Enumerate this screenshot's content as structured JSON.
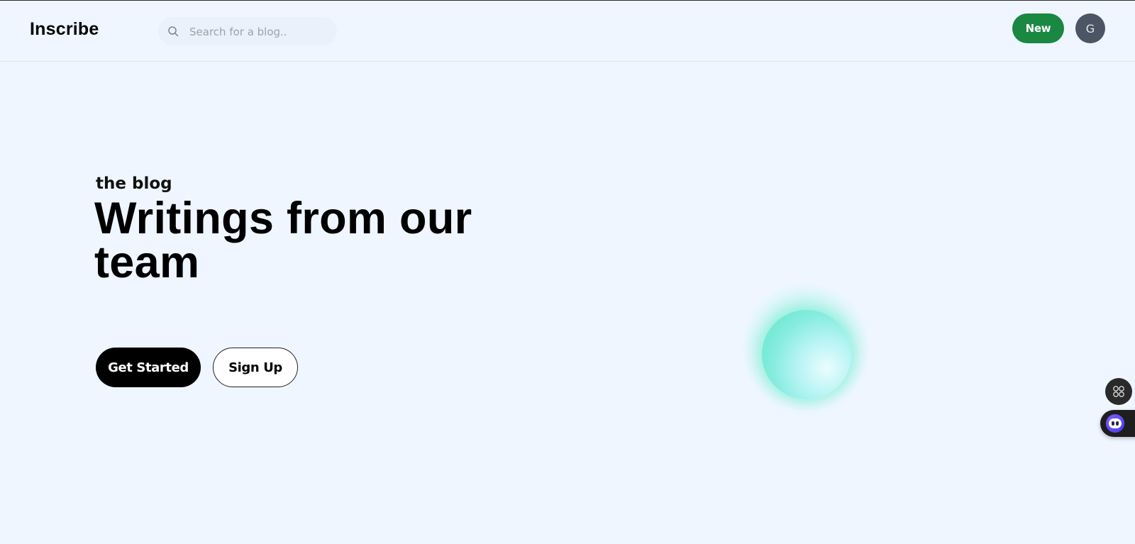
{
  "brand": {
    "name": "Inscribe"
  },
  "search": {
    "placeholder": "Search for a blog.."
  },
  "header": {
    "new_label": "New",
    "avatar_initial": "G"
  },
  "hero": {
    "eyebrow": "the blog",
    "title": "Writings from our team",
    "primary_cta": "Get Started",
    "secondary_cta": "Sign Up"
  },
  "icons": {
    "search": "search-icon",
    "floating_apps": "apps-grid-icon",
    "assistant": "assistant-bot-icon"
  },
  "colors": {
    "background": "#eff6ff",
    "new_button": "#1a8742",
    "avatar": "#4b5563",
    "primary_cta": "#000000",
    "orb_accent": "#5fe6c4"
  }
}
